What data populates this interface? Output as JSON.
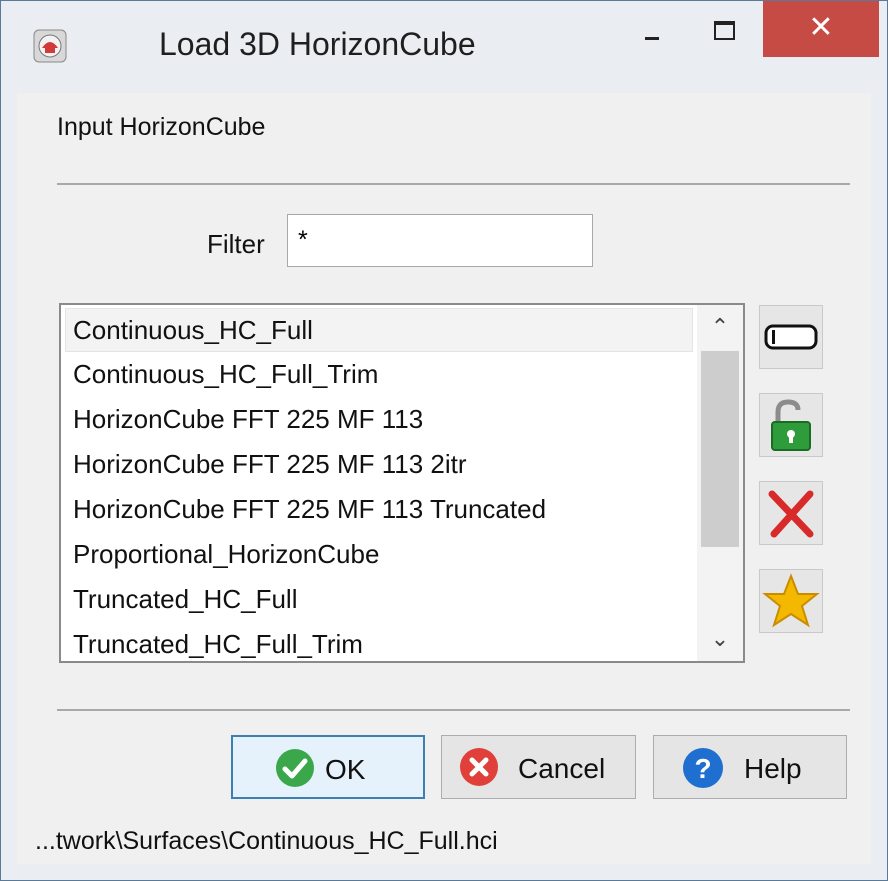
{
  "window": {
    "title": "Load 3D HorizonCube",
    "close_glyph": "✕"
  },
  "header": {
    "input_label": "Input HorizonCube"
  },
  "filter": {
    "label": "Filter",
    "value": "*"
  },
  "list": {
    "items": [
      "Continuous_HC_Full",
      "Continuous_HC_Full_Trim",
      "HorizonCube FFT 225 MF 113",
      "HorizonCube FFT 225 MF 113 2itr",
      "HorizonCube FFT 225 MF 113 Truncated",
      "Proportional_HorizonCube",
      "Truncated_HC_Full",
      "Truncated_HC_Full_Trim"
    ],
    "selected": "Continuous_HC_Full",
    "scroll_up_glyph": "⌃",
    "scroll_down_glyph": "⌄"
  },
  "side_buttons": [
    {
      "icon": "rename-icon"
    },
    {
      "icon": "unlock-icon"
    },
    {
      "icon": "delete-icon"
    },
    {
      "icon": "star-icon"
    }
  ],
  "buttons": {
    "ok": "OK",
    "cancel": "Cancel",
    "help": "Help"
  },
  "status": {
    "path": "...twork\\Surfaces\\Continuous_HC_Full.hci"
  },
  "colors": {
    "close": "#c74b45",
    "ok_icon": "#3aa84a",
    "cancel_icon": "#e0403a",
    "help_icon": "#1f6fd1",
    "star": "#f5b800",
    "lock": "#2f9c3c"
  }
}
